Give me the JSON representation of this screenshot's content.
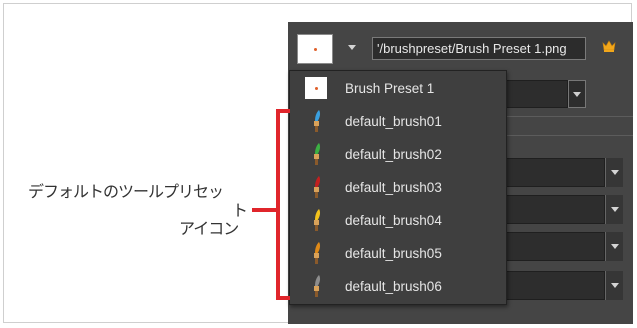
{
  "toolbar": {
    "preset_path": "'/brushpreset/Brush Preset 1.png"
  },
  "dropdown": {
    "items": [
      {
        "label": "Brush Preset 1",
        "icon": "brush-preset-thumbnail-icon"
      },
      {
        "label": "default_brush01",
        "icon": "brush-icon",
        "color": "#3aa0e0"
      },
      {
        "label": "default_brush02",
        "icon": "brush-icon",
        "color": "#3cb043"
      },
      {
        "label": "default_brush03",
        "icon": "brush-icon",
        "color": "#c21f1f"
      },
      {
        "label": "default_brush04",
        "icon": "brush-icon",
        "color": "#f2c21c"
      },
      {
        "label": "default_brush05",
        "icon": "brush-icon",
        "color": "#e08a18"
      },
      {
        "label": "default_brush06",
        "icon": "brush-icon",
        "color": "#8d8d8d"
      }
    ]
  },
  "callout": {
    "line1": "デフォルトのツールプリセッ",
    "line2": "ト",
    "line3": "アイコン",
    "color": "#e0252b"
  }
}
